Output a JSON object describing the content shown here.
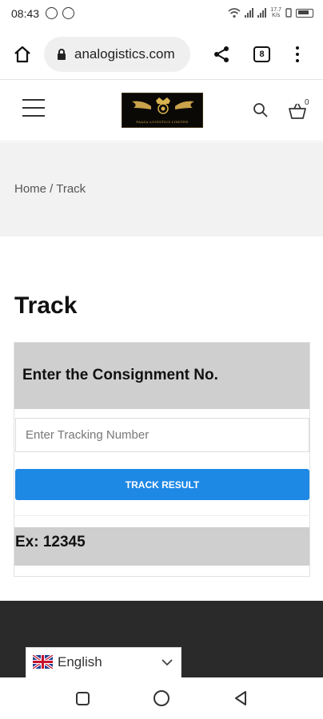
{
  "status_bar": {
    "time": "08:43",
    "net_speed": "17.7\nK/s",
    "icons": [
      "whatsapp-icon",
      "sync-icon",
      "wifi-icon",
      "signal-icon",
      "signal-icon",
      "vibrate-icon",
      "battery-icon"
    ]
  },
  "browser": {
    "url": "analogistics.com",
    "tab_count": "8",
    "icons": [
      "home-icon",
      "lock-icon",
      "share-icon",
      "tabs-icon",
      "more-icon"
    ]
  },
  "site_header": {
    "logo_text": "FAASA LOGISTICS LIMITED",
    "cart_count": "0",
    "icons": [
      "hamburger-menu-icon",
      "search-icon",
      "cart-icon"
    ]
  },
  "breadcrumb": {
    "text": "Home / Track"
  },
  "main": {
    "title": "Track",
    "track_form": {
      "heading": "Enter the Consignment No.",
      "input_placeholder": "Enter Tracking Number",
      "input_value": "",
      "button_label": "TRACK RESULT",
      "example": "Ex: 12345"
    }
  },
  "footer": {
    "language": "English",
    "icons": [
      "uk-flag-icon",
      "chevron-down-icon"
    ]
  },
  "colors": {
    "primary_button": "#1e88e5",
    "form_header_bg": "#cfcfcf",
    "footer_bg": "#2a2a2a",
    "breadcrumb_bg": "#f2f2f2"
  }
}
